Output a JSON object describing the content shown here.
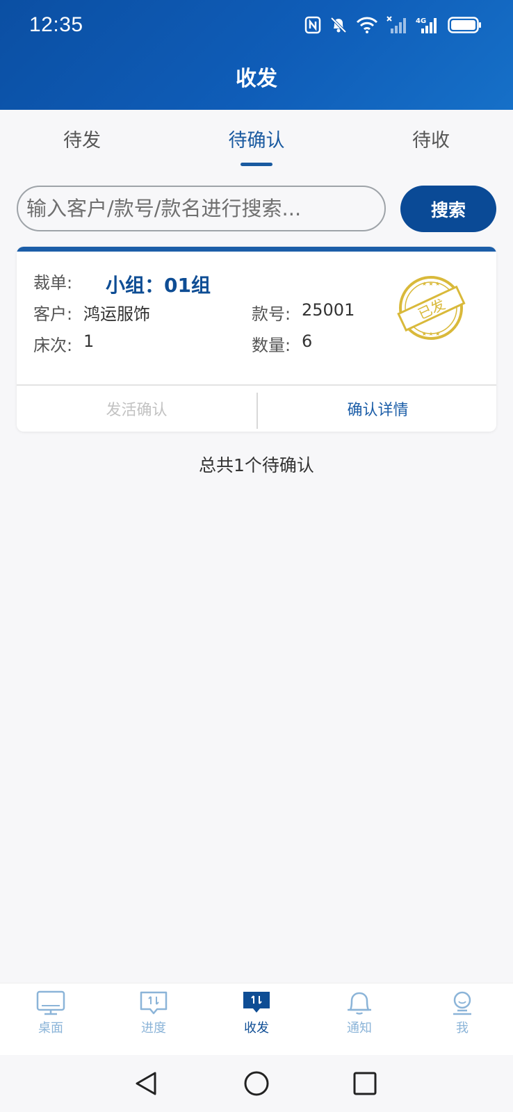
{
  "status_bar": {
    "time": "12:35",
    "network_label": "4G"
  },
  "header": {
    "title": "收发"
  },
  "tabs": [
    {
      "label": "待发",
      "active": false
    },
    {
      "label": "待确认",
      "active": true
    },
    {
      "label": "待收",
      "active": false
    }
  ],
  "search": {
    "placeholder": "输入客户/款号/款名进行搜索...",
    "button_label": "搜索"
  },
  "card": {
    "order_label": "裁单:",
    "group_value": "小组：01组",
    "customer_label": "客户:",
    "customer_value": "鸿运服饰",
    "style_label": "款号:",
    "style_value": "25001",
    "bed_label": "床次:",
    "bed_value": "1",
    "qty_label": "数量:",
    "qty_value": "6",
    "stamp_text": "已发",
    "left_action": "发活确认",
    "right_action": "确认详情"
  },
  "total_text": "总共1个待确认",
  "bottom_nav": [
    {
      "label": "桌面",
      "icon": "desktop-icon",
      "active": false
    },
    {
      "label": "进度",
      "icon": "progress-icon",
      "active": false
    },
    {
      "label": "收发",
      "icon": "transfer-icon",
      "active": true
    },
    {
      "label": "通知",
      "icon": "bell-icon",
      "active": false
    },
    {
      "label": "我",
      "icon": "profile-icon",
      "active": false
    }
  ],
  "colors": {
    "brand": "#0a4a96",
    "header_gradient_start": "#0b4fa3",
    "header_gradient_end": "#1670c8",
    "tab_active": "#1a5aa0",
    "stamp": "#d9b93a",
    "nav_inactive": "#8bb4d8"
  }
}
